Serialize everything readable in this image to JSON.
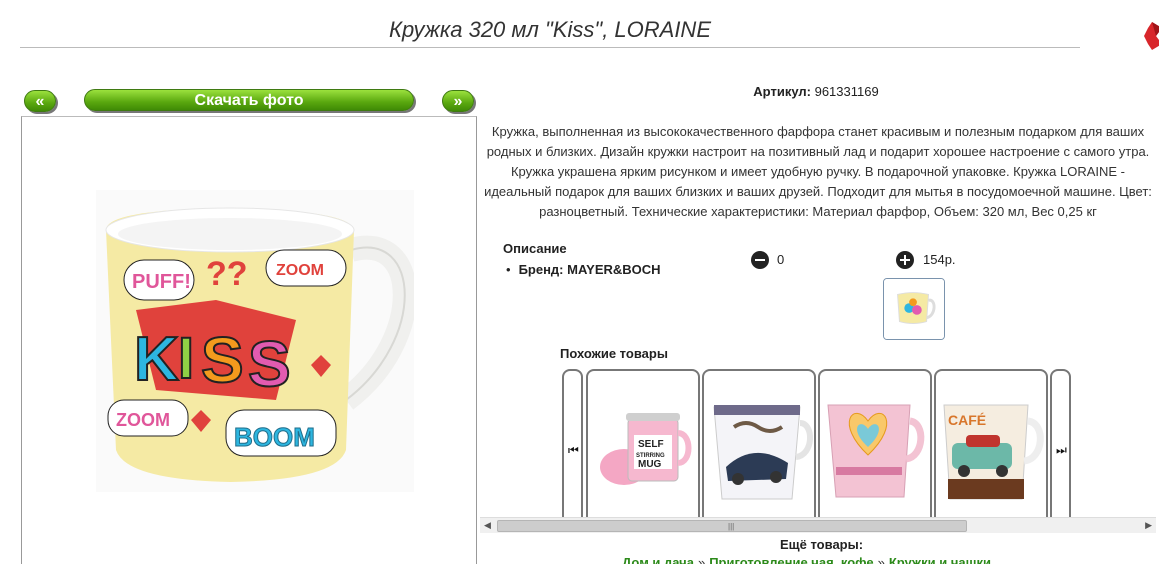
{
  "page": {
    "title": "Кружка 320 мл \"Kiss\", LORAINE"
  },
  "gallery": {
    "prev_label": "«",
    "download_label": "Скачать фото",
    "next_label": "»"
  },
  "product": {
    "sku_label": "Артикул:",
    "sku_value": "961331169",
    "description": "Кружка, выполненная из высококачественного фарфора станет красивым и полезным подарком для ваших родных и близких. Дизайн кружки настроит на позитивный лад и подарит хорошее настроение с самого утра. Кружка украшена ярким рисунком и имеет удобную ручку. В подарочной упаковке. Кружка LORAINE - идеальный подарок для ваших близких и ваших друзей. Подходит для мытья в посудомоечной машине. Цвет: разноцветный. Технические характеристики: Материал фарфор, Объем: 320 мл, Вес 0,25 кг",
    "spec_title": "Описание",
    "brand_line": "Бренд: MAYER&BOCH",
    "qty": "0",
    "price": "154р."
  },
  "similar": {
    "title": "Похожие товары",
    "items": [
      {
        "label": "SELF STIRRING MUG"
      },
      {
        "label": "Кружка с автомобилем"
      },
      {
        "label": "Кружка с сердцем"
      },
      {
        "label": "Кружка Café"
      }
    ]
  },
  "more": {
    "title": "Ещё товары:",
    "crumbs": [
      "Дом и дача",
      "Приготовление чая, кофе",
      "Кружки и чашки"
    ]
  },
  "colors": {
    "accent_green": "#5aa80f",
    "link_green": "#2c8a1a",
    "close_red": "#d8262b"
  },
  "icons": {
    "close": "close-x-icon",
    "minus": "minus-circle-icon",
    "plus": "plus-circle-icon"
  }
}
